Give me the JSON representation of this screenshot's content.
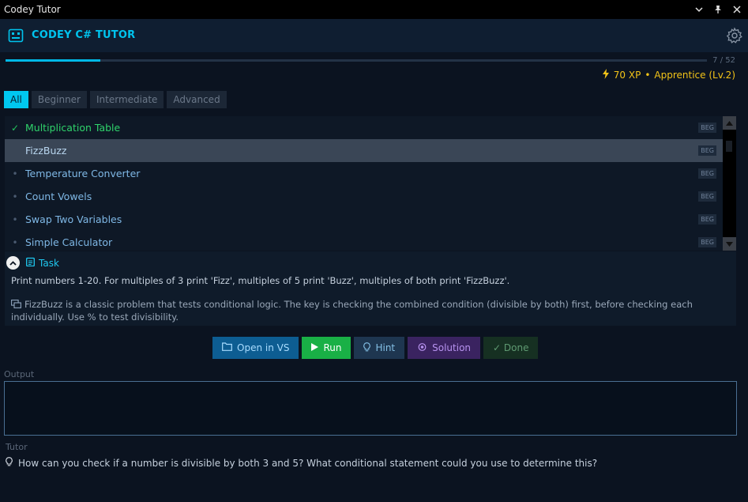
{
  "window": {
    "title": "Codey Tutor"
  },
  "app": {
    "title": "CODEY C# TUTOR"
  },
  "progress": {
    "current": 7,
    "total": 52,
    "label": "7 / 52",
    "fraction": 0.135
  },
  "stats": {
    "xp": "70 XP",
    "separator": "•",
    "rank": "Apprentice (Lv.2)"
  },
  "filters": [
    {
      "label": "All",
      "active": true
    },
    {
      "label": "Beginner",
      "active": false
    },
    {
      "label": "Intermediate",
      "active": false
    },
    {
      "label": "Advanced",
      "active": false
    }
  ],
  "exercises": [
    {
      "name": "Multiplication Table",
      "badge": "BEG",
      "done": true,
      "selected": false
    },
    {
      "name": "FizzBuzz",
      "badge": "BEG",
      "done": false,
      "selected": true
    },
    {
      "name": "Temperature Converter",
      "badge": "BEG",
      "done": false,
      "selected": false
    },
    {
      "name": "Count Vowels",
      "badge": "BEG",
      "done": false,
      "selected": false
    },
    {
      "name": "Swap Two Variables",
      "badge": "BEG",
      "done": false,
      "selected": false
    },
    {
      "name": "Simple Calculator",
      "badge": "BEG",
      "done": false,
      "selected": false
    }
  ],
  "task": {
    "title": "Task",
    "description": "Print numbers 1-20. For multiples of 3 print 'Fizz', multiples of 5 print 'Buzz', multiples of both print 'FizzBuzz'.",
    "note": "FizzBuzz is a classic problem that tests conditional logic. The key is checking the combined condition (divisible by both) first, before checking each individually. Use % to test divisibility."
  },
  "actions": {
    "open": "Open in VS",
    "run": "Run",
    "hint": "Hint",
    "solution": "Solution",
    "done": "✓ Done"
  },
  "output": {
    "label": "Output",
    "text": ""
  },
  "tutor": {
    "label": "Tutor",
    "message": "How can you check if a number is divisible by both 3 and 5? What conditional statement could you use to determine this?"
  },
  "colors": {
    "accent": "#00c4ee",
    "xp": "#f2c318",
    "success": "#19b046"
  },
  "icons": [
    "app-logo-icon",
    "chevron-down-icon",
    "pin-icon",
    "close-icon",
    "gear-icon",
    "lightning-icon",
    "check-icon",
    "bullet-icon",
    "collapse-icon",
    "clipboard-icon",
    "info-icon",
    "folder-icon",
    "play-icon",
    "lightbulb-icon",
    "eye-icon"
  ]
}
